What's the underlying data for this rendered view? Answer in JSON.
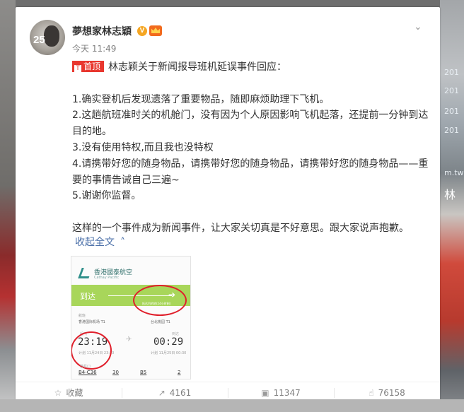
{
  "post": {
    "author": "夢想家林志穎",
    "verified_badge": "V",
    "time": "今天 11:49",
    "top_tag": "首顶",
    "top_tag_pin": "T",
    "paragraphs": [
      "林志颖关于新闻报导班机延误事件回应：",
      "",
      "1.确实登机后发现遗落了重要物品，随即麻烦助理下飞机。",
      "2.这趟航班准时关的机舱门，没有因为个人原因影响飞机起落，还提前一分钟到达目的地。",
      "3.没有使用特权,而且我也没特权",
      "4.请携带好您的随身物品，请携带好您的随身物品，请携带好您的随身物品——重要的事情告诫自己三遍~",
      "5.谢谢你监督。",
      "",
      "这样的一个事件成为新闻事件，让大家关切真是不好意思。跟大家说声抱歉。"
    ],
    "collapse_label": "收起全文",
    "avatar_number": "25"
  },
  "boarding_pass": {
    "airline_cn": "香港國泰航空",
    "airline_en": "Cathay Pacific",
    "status": "到达",
    "status_sub": "抵达目的地(24小时制)",
    "flight_label": "航班",
    "from_city": "香港国际机场 T1",
    "to_city": "台北桃园 T1",
    "depart_label": "起飞",
    "arrive_label": "到达",
    "depart_time": "23:19",
    "arrive_time": "00:29",
    "depart_note": "计划 11月24日 23:20",
    "arrive_note": "计划 11月25日 00:30",
    "gate_label_1": "登机口",
    "gate_1": "B4-C36",
    "gate_2": "30",
    "gate_3": "B5",
    "gate_4": "2"
  },
  "actions": {
    "favorite_label": "收藏",
    "repost_count": "4161",
    "comment_count": "11347",
    "like_count": "76158"
  },
  "background": {
    "signs": [
      "201",
      "201",
      "201",
      "201",
      "m.tw",
      "林"
    ]
  },
  "colors": {
    "accent_link": "#4a6fa8",
    "top_tag": "#e8372e",
    "pass_band": "#a8d65a",
    "circle_mark": "#e01f2b"
  }
}
